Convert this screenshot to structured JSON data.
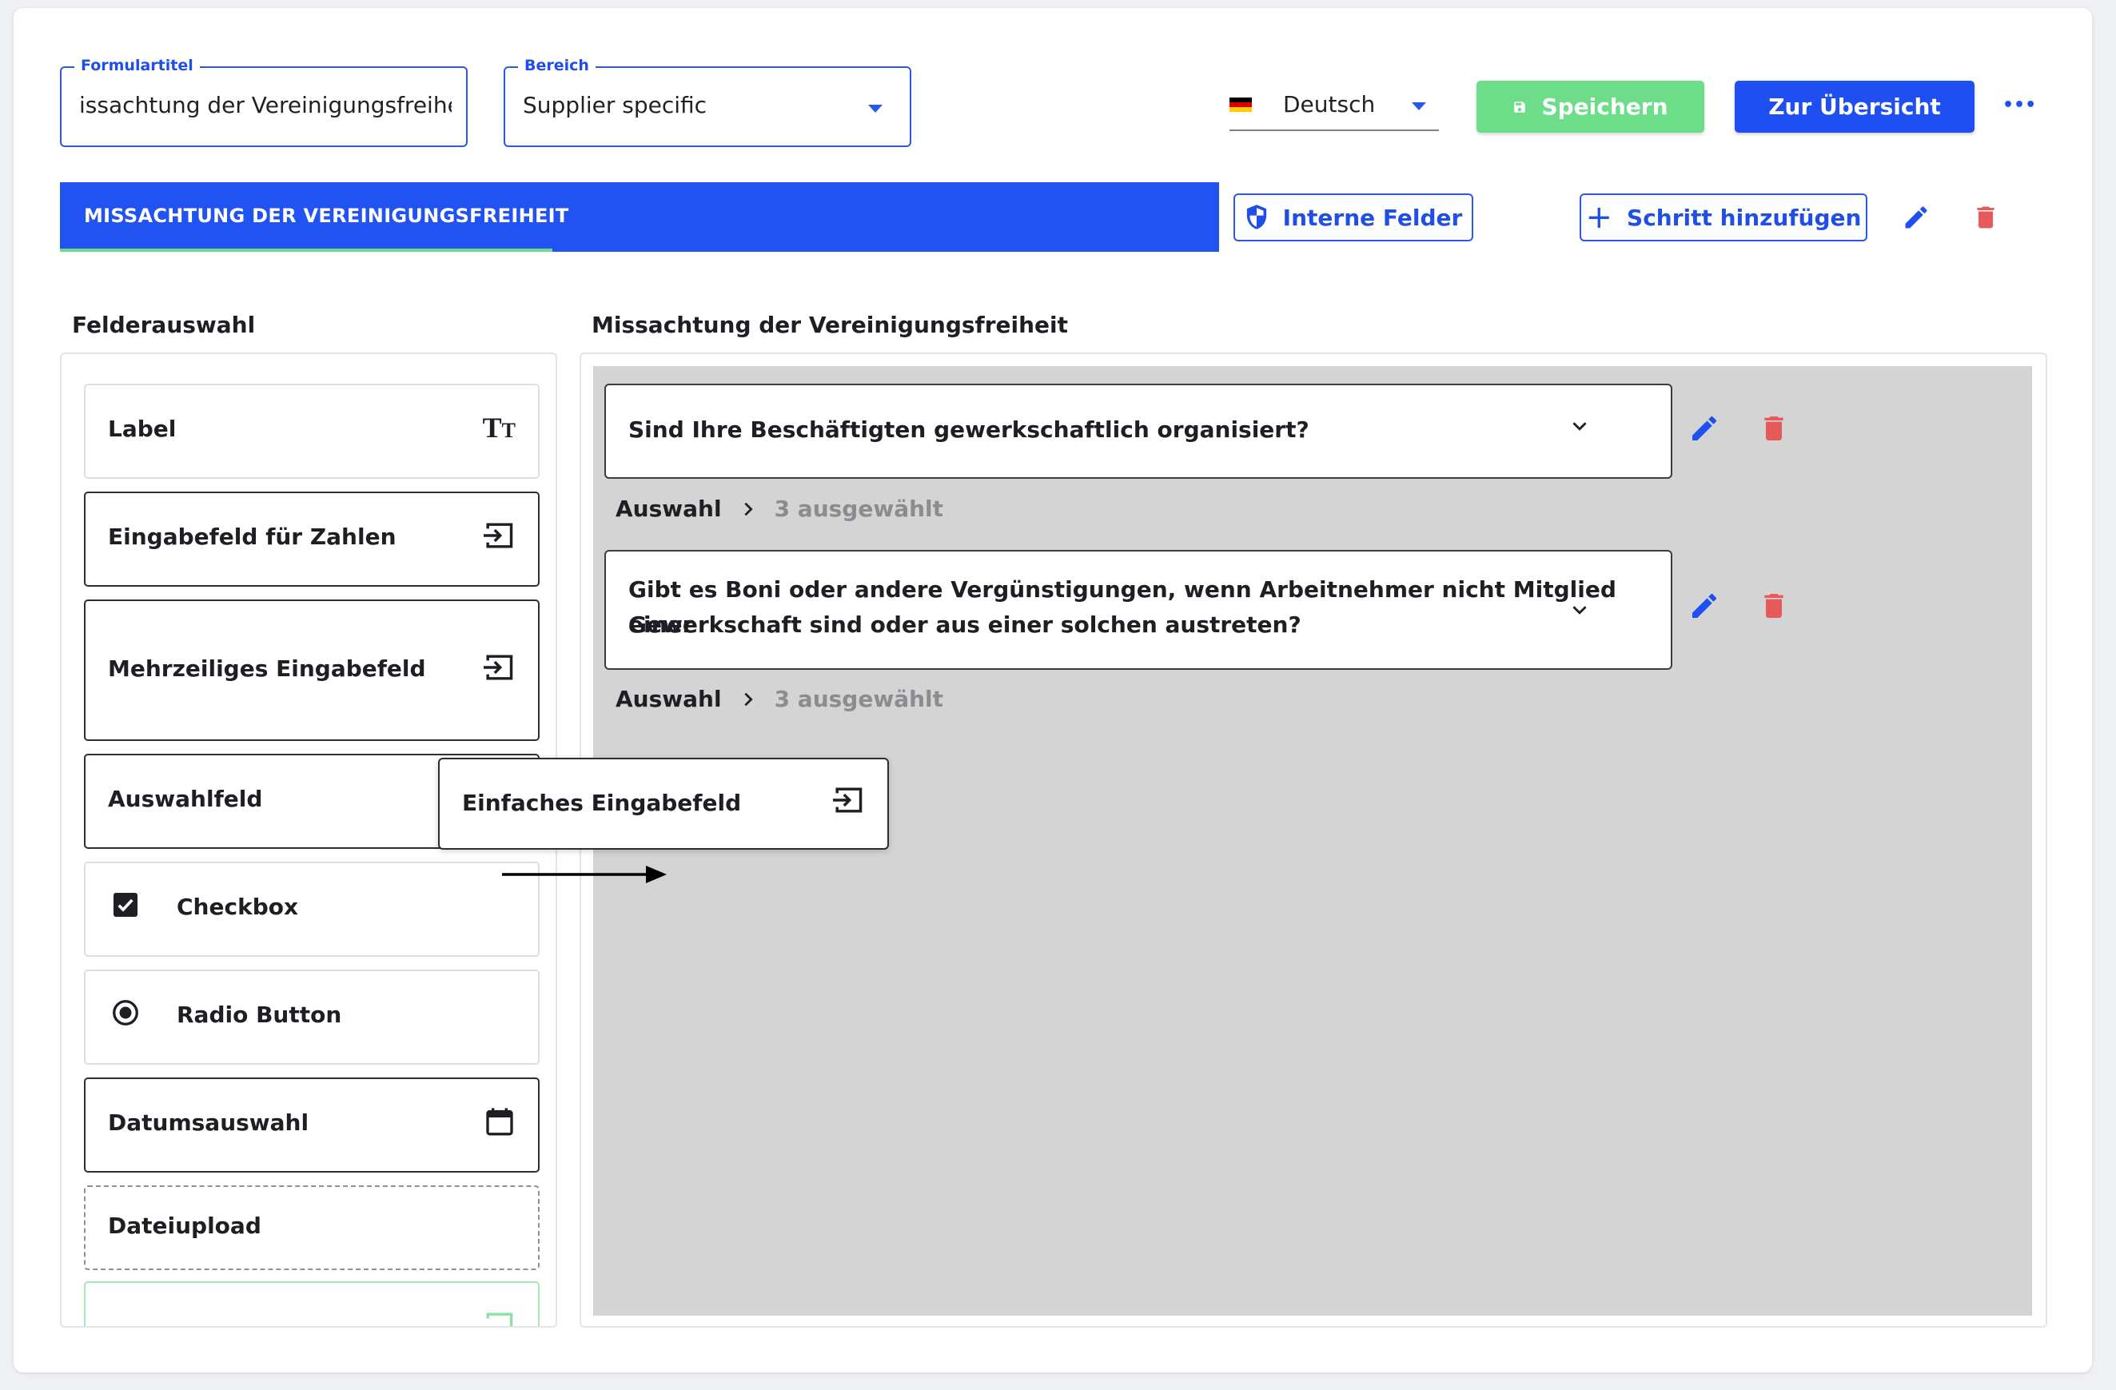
{
  "header": {
    "form_title_label": "Formulartitel",
    "form_title_value": "issachtung der Vereinigungsfreiheit",
    "area_label": "Bereich",
    "area_value": "Supplier specific",
    "language_value": "Deutsch",
    "save_label": "Speichern",
    "overview_label": "Zur Übersicht",
    "more_label": "•••"
  },
  "step_bar": {
    "active_tab_label": "MISSACHTUNG DER VEREINIGUNGSFREIHEIT",
    "internal_fields_label": "Interne Felder",
    "add_step_label": "Schritt hinzufügen"
  },
  "palette": {
    "title": "Felderauswahl",
    "items": [
      {
        "label": "Label",
        "icon": "text-format-icon"
      },
      {
        "label": "Eingabefeld für Zahlen",
        "icon": "input-icon"
      },
      {
        "label": "Mehrzeiliges Eingabefeld",
        "icon": "input-icon"
      },
      {
        "label": "Auswahlfeld",
        "icon": "input-icon"
      },
      {
        "label": "Checkbox",
        "icon": "checkbox-checked-icon"
      },
      {
        "label": "Radio Button",
        "icon": "radio-checked-icon"
      },
      {
        "label": "Datumsauswahl",
        "icon": "calendar-icon"
      },
      {
        "label": "Dateiupload",
        "icon": ""
      },
      {
        "label": "",
        "icon": "input-icon"
      }
    ]
  },
  "canvas": {
    "title": "Missachtung der Vereinigungsfreiheit",
    "questions": [
      {
        "text": "Sind Ihre Beschäftigten gewerkschaftlich organisiert?",
        "option_label": "Auswahl",
        "option_count": "3 ausgewählt"
      },
      {
        "text_line1": "Gibt es Boni oder andere Vergünstigungen, wenn Arbeitnehmer nicht Mitglied einer",
        "text_line2": "Gewerkschaft sind oder aus einer solchen austreten?",
        "option_label": "Auswahl",
        "option_count": "3 ausgewählt"
      }
    ]
  },
  "drag": {
    "label": "Einfaches Eingabefeld",
    "icon": "input-icon"
  },
  "colors": {
    "primary": "#1f4ff0",
    "success": "#6ddd8a",
    "danger": "#e85a5a",
    "canvas_bg": "#d4d4d4"
  }
}
